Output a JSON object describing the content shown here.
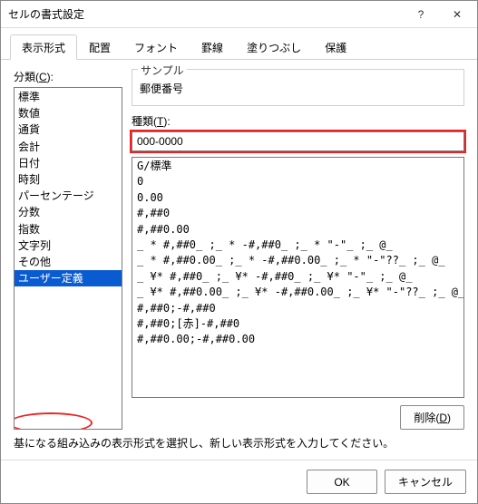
{
  "window": {
    "title": "セルの書式設定",
    "help_icon": "?",
    "close_icon": "✕"
  },
  "tabs": [
    {
      "label": "表示形式",
      "active": true
    },
    {
      "label": "配置"
    },
    {
      "label": "フォント"
    },
    {
      "label": "罫線"
    },
    {
      "label": "塗りつぶし"
    },
    {
      "label": "保護"
    }
  ],
  "category": {
    "label_prefix": "分類(",
    "label_u": "C",
    "label_suffix": "):",
    "items": [
      "標準",
      "数値",
      "通貨",
      "会計",
      "日付",
      "時刻",
      "パーセンテージ",
      "分数",
      "指数",
      "文字列",
      "その他",
      "ユーザー定義"
    ],
    "selected": "ユーザー定義"
  },
  "sample": {
    "label": "サンプル",
    "value": "郵便番号"
  },
  "type": {
    "label_prefix": "種類(",
    "label_u": "T",
    "label_suffix": "):",
    "value": "000-0000"
  },
  "formats": [
    "G/標準",
    "0",
    "0.00",
    "#,##0",
    "#,##0.00",
    "_ * #,##0_ ;_ * -#,##0_ ;_ * \"-\"_ ;_ @_",
    "_ * #,##0.00_ ;_ * -#,##0.00_ ;_ * \"-\"??_ ;_ @_",
    "_ ¥* #,##0_ ;_ ¥* -#,##0_ ;_ ¥* \"-\"_ ;_ @_",
    "_ ¥* #,##0.00_ ;_ ¥* -#,##0.00_ ;_ ¥* \"-\"??_ ;_ @_",
    "#,##0;-#,##0",
    "#,##0;[赤]-#,##0",
    "#,##0.00;-#,##0.00"
  ],
  "delete_button": {
    "prefix": "削除(",
    "u": "D",
    "suffix": ")"
  },
  "hint": "基になる組み込みの表示形式を選択し、新しい表示形式を入力してください。",
  "footer": {
    "ok": "OK",
    "cancel": "キャンセル"
  }
}
